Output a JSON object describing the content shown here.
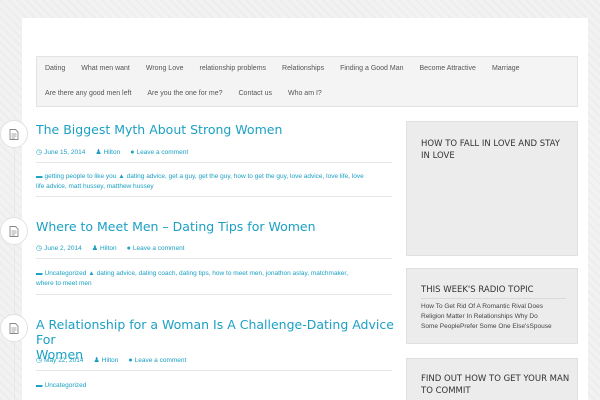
{
  "nav": {
    "row1": [
      "Dating",
      "What men want",
      "Wrong Love",
      "relationship problems",
      "Relationships",
      "Finding a Good Man",
      "Become Attractive",
      "Marriage"
    ],
    "row2": [
      "Are there any good men left",
      "Are you the one for me?",
      "Contact us",
      "Who am I?"
    ]
  },
  "posts": [
    {
      "title": "The Biggest Myth About Strong Women",
      "date": "June 15, 2014",
      "author": "Hilton",
      "comment": "Leave a comment",
      "tags_line1": "getting people to like you",
      "tags_line1b": "dating advice, get a guy, get the guy, how to get the guy, love advice, love life, love",
      "tags_line2": "life advice, matt hussey, matthew hussey"
    },
    {
      "title": "Where to Meet Men – Dating Tips for Women",
      "date": "June 2, 2014",
      "author": "Hilton",
      "comment": "Leave a comment",
      "category": "Uncategorized",
      "tags_line1": "dating advice, dating coach, dating tips, how to meet men, jonathon aslay, matchmaker,",
      "tags_line2": "where to meet men"
    },
    {
      "title_line1": "A Relationship for a Woman Is A Challenge-Dating Advice For",
      "title_line2": "Women",
      "date": "May 22, 2014",
      "author": "Hilton",
      "comment": "Leave a comment",
      "category": "Uncategorized"
    }
  ],
  "sidebar": {
    "widget1_title_line1": "HOW TO FALL IN LOVE AND STAY",
    "widget1_title_line2": "IN LOVE",
    "widget2_title": "THIS WEEK'S RADIO TOPIC",
    "widget2_text_line1": "How To Get Rid Of A Romantic Rival  Does",
    "widget2_text_line2": "Religion Matter In Relationships Why Do",
    "widget2_text_line3": "Some PeoplePrefer Some One Else'sSpouse",
    "widget3_title_line1": "FIND OUT HOW TO GET YOUR MAN",
    "widget3_title_line2": "TO COMMIT"
  },
  "icons": {
    "post": "document-icon",
    "date": "calendar-icon",
    "author": "user-icon",
    "comment": "comment-icon",
    "folder": "folder-icon",
    "tag": "tag-icon"
  },
  "colors": {
    "accent": "#1ba0c4",
    "background": "#f2f2f2",
    "widget": "#ececec"
  }
}
